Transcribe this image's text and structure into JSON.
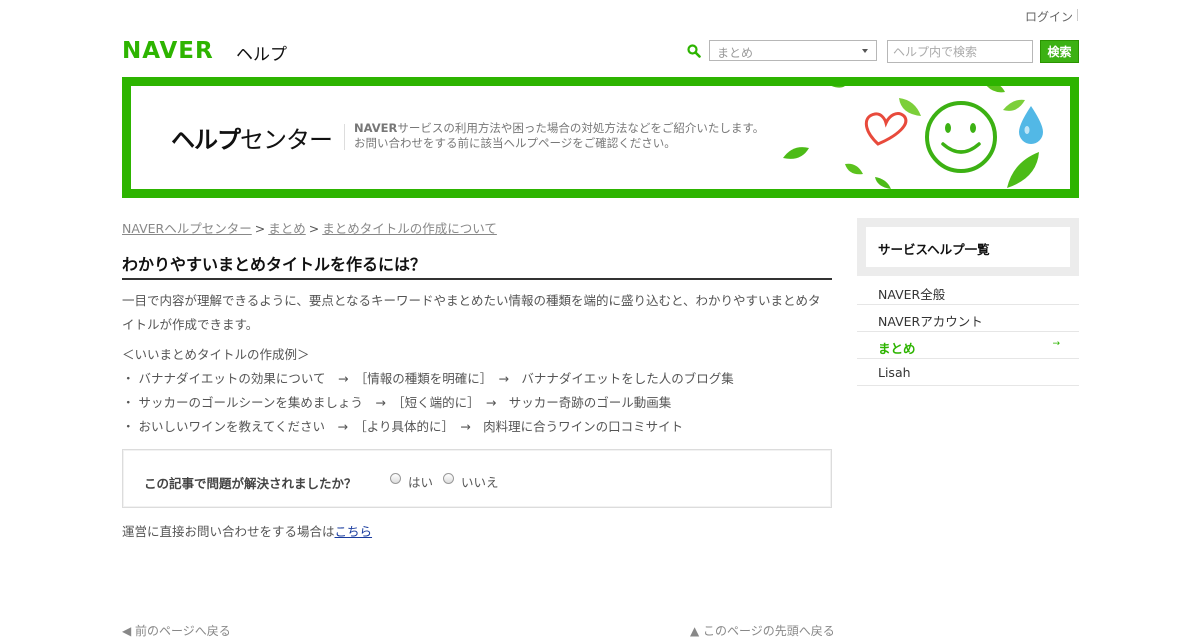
{
  "header": {
    "login_label": "ログイン",
    "logo_text": "NAVER",
    "help_label": "ヘルプ",
    "service_select_value": "まとめ",
    "search_placeholder": "ヘルプ内で検索",
    "search_button_label": "検索"
  },
  "banner": {
    "title_bold": "ヘルプ",
    "title_rest": "センター",
    "desc_brand": "NAVER",
    "desc_line1": "サービスの利用方法や困った場合の対処方法などをご紹介いたします。",
    "desc_line2": "お問い合わせをする前に該当ヘルプページをご確認ください。"
  },
  "breadcrumb": {
    "items": [
      "NAVERヘルプセンター",
      "まとめ",
      "まとめタイトルの作成について"
    ],
    "separator": ">"
  },
  "article": {
    "title": "わかりやすいまとめタイトルを作るには？",
    "intro": "一目で内容が理解できるように、要点となるキーワードやまとめたい情報の種類を端的に盛り込むと、わかりやすいまとめタイトルが作成できます。",
    "examples_heading": "＜いいまとめタイトルの作成例＞",
    "examples": [
      "・ バナナダイエットの効果について　→　［情報の種類を明確に］　→　バナナダイエットをした人のブログ集",
      "・ サッカーのゴールシーンを集めましょう　→　［短く端的に］　→　サッカー奇跡のゴール動画集",
      "・ おいしいワインを教えてください　→　［より具体的に］　→　肉料理に合うワインの口コミサイト"
    ]
  },
  "feedback": {
    "question": "この記事で問題が解決されましたか？",
    "option_yes": "はい",
    "option_no": "いいえ"
  },
  "contact": {
    "text": "運営に直接お問い合わせをする場合は",
    "link_label": "こちら"
  },
  "footer_nav": {
    "back_label": "◀ 前のページへ戻る",
    "top_label": "▲ このページの先頭へ戻る"
  },
  "sidebar": {
    "title": "サービスヘルプ一覧",
    "items": [
      {
        "label": "NAVER全般"
      },
      {
        "label": "NAVERアカウント"
      },
      {
        "label": "まとめ",
        "active": true
      },
      {
        "label": "Lisah"
      }
    ],
    "active_arrow": "→"
  },
  "colors": {
    "brand_green": "#2db400",
    "link_blue": "#1a3c9e"
  },
  "icons": [
    "search-icon",
    "select-arrow-icon",
    "heart-icon",
    "smiley-icon",
    "water-drop-icon",
    "leaf-icon",
    "arrow-right-icon"
  ]
}
